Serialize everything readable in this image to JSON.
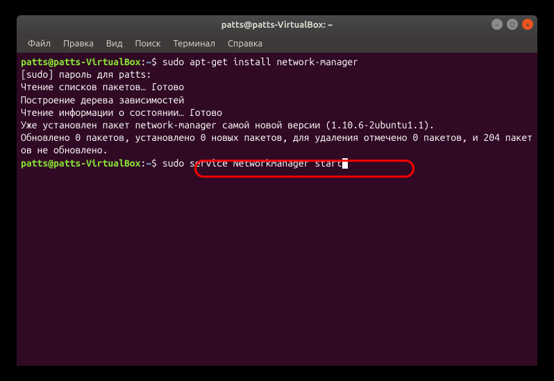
{
  "window": {
    "title": "patts@patts-VirtualBox: ~"
  },
  "menubar": {
    "items": [
      "Файл",
      "Правка",
      "Вид",
      "Поиск",
      "Терминал",
      "Справка"
    ]
  },
  "prompt": {
    "user_host": "patts@patts-VirtualBox",
    "path": "~",
    "symbol": "$"
  },
  "lines": {
    "cmd1": "sudo apt-get install network-manager",
    "out1": "[sudo] пароль для patts:",
    "out2": "Чтение списков пакетов… Готово",
    "out3": "Построение дерева зависимостей",
    "out4": "Чтение информации о состоянии… Готово",
    "out5": "Уже установлен пакет network-manager самой новой версии (1.10.6-2ubuntu1.1).",
    "out6": "Обновлено 0 пакетов, установлено 0 новых пакетов, для удаления отмечено 0 пакетов, и 204 пакетов не обновлено.",
    "cmd2": "sudo service NetworkManager start"
  },
  "controls": {
    "min": "−",
    "max": "□",
    "close": "×"
  }
}
